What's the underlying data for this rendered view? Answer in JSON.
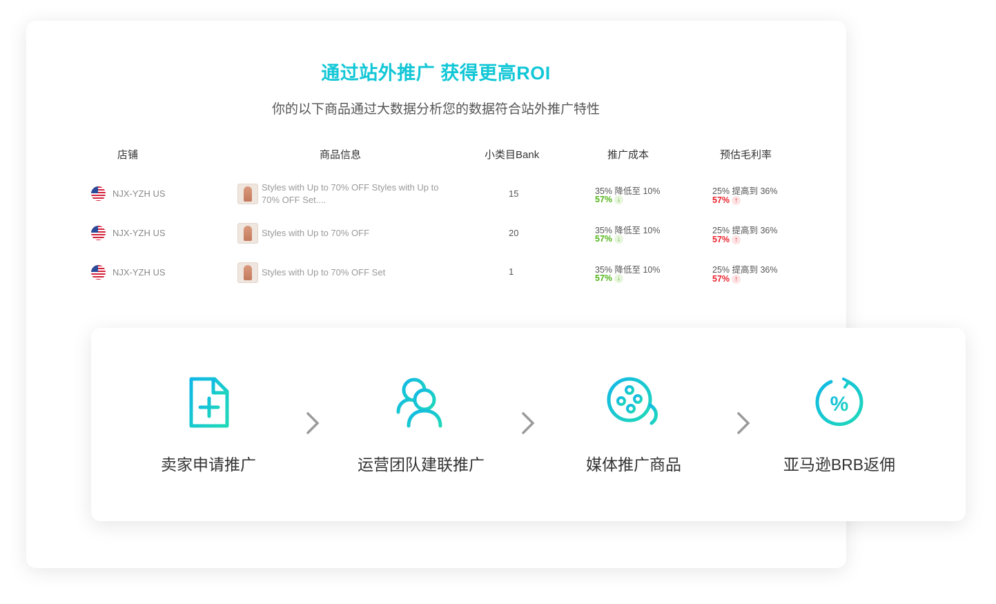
{
  "headline": "通过站外推广 获得更高ROI",
  "subtitle": "你的以下商品通过大数据分析您的数据符合站外推广特性",
  "table": {
    "headers": {
      "store": "店铺",
      "product": "商品信息",
      "rank": "小类目Bank",
      "cost": "推广成本",
      "margin": "预估毛利率"
    },
    "rows": [
      {
        "store": "NJX-YZH US",
        "product": "Styles with Up to 70% OFF Styles with Up to 70% OFF Set....",
        "rank": "15",
        "cost_text": "35% 降低至 10%",
        "cost_change": "57%",
        "margin_text": "25% 提高到 36%",
        "margin_change": "57%"
      },
      {
        "store": "NJX-YZH US",
        "product": "Styles with Up to 70% OFF",
        "rank": "20",
        "cost_text": "35% 降低至 10%",
        "cost_change": "57%",
        "margin_text": "25% 提高到 36%",
        "margin_change": "57%"
      },
      {
        "store": "NJX-YZH US",
        "product": "Styles with Up to 70% OFF Set",
        "rank": "1",
        "cost_text": "35% 降低至 10%",
        "cost_change": "57%",
        "margin_text": "25% 提高到 36%",
        "margin_change": "57%"
      }
    ]
  },
  "steps": [
    {
      "label": "卖家申请推广",
      "icon": "document-plus-icon"
    },
    {
      "label": "运营团队建联推广",
      "icon": "team-users-icon"
    },
    {
      "label": "媒体推广商品",
      "icon": "film-reel-icon"
    },
    {
      "label": "亚马逊BRB返佣",
      "icon": "percent-rebate-icon"
    }
  ],
  "colors": {
    "accent": "#12c7d6",
    "green": "#52b41a",
    "red": "#ea1f2a"
  }
}
